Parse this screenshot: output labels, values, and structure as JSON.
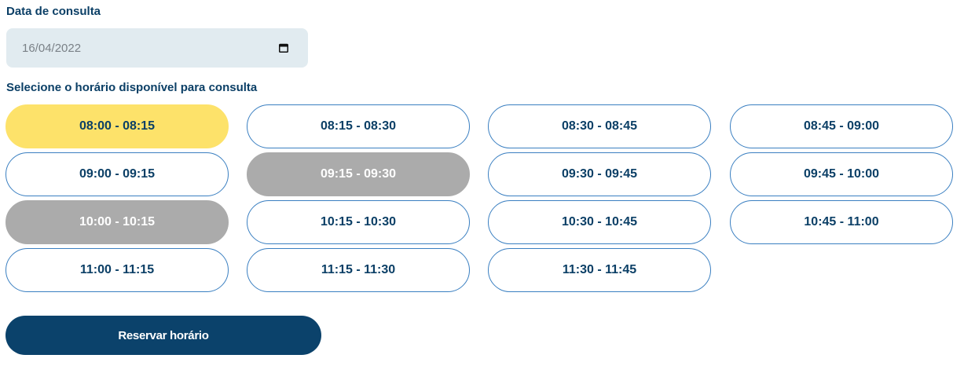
{
  "date_section": {
    "label": "Data de consulta",
    "value": "16/04/2022",
    "icon": "calendar-icon"
  },
  "slots_section": {
    "label": "Selecione o horário disponível para consulta",
    "slots": [
      {
        "label": "08:00 - 08:15",
        "state": "selected"
      },
      {
        "label": "08:15 - 08:30",
        "state": "available"
      },
      {
        "label": "08:30 - 08:45",
        "state": "available"
      },
      {
        "label": "08:45 - 09:00",
        "state": "available"
      },
      {
        "label": "09:00 - 09:15",
        "state": "available"
      },
      {
        "label": "09:15 - 09:30",
        "state": "unavailable"
      },
      {
        "label": "09:30 - 09:45",
        "state": "available"
      },
      {
        "label": "09:45 - 10:00",
        "state": "available"
      },
      {
        "label": "10:00 - 10:15",
        "state": "unavailable"
      },
      {
        "label": "10:15 - 10:30",
        "state": "available"
      },
      {
        "label": "10:30 - 10:45",
        "state": "available"
      },
      {
        "label": "10:45 - 11:00",
        "state": "available"
      },
      {
        "label": "11:00 - 11:15",
        "state": "available"
      },
      {
        "label": "11:15 - 11:30",
        "state": "available"
      },
      {
        "label": "11:30 - 11:45",
        "state": "available"
      }
    ]
  },
  "reserve_button": {
    "label": "Reservar horário"
  },
  "colors": {
    "primary": "#0b426b",
    "selected": "#fde26a",
    "unavailable": "#ababab",
    "slot_border": "#3a7fc1",
    "date_field_bg": "#e1ebf0"
  }
}
